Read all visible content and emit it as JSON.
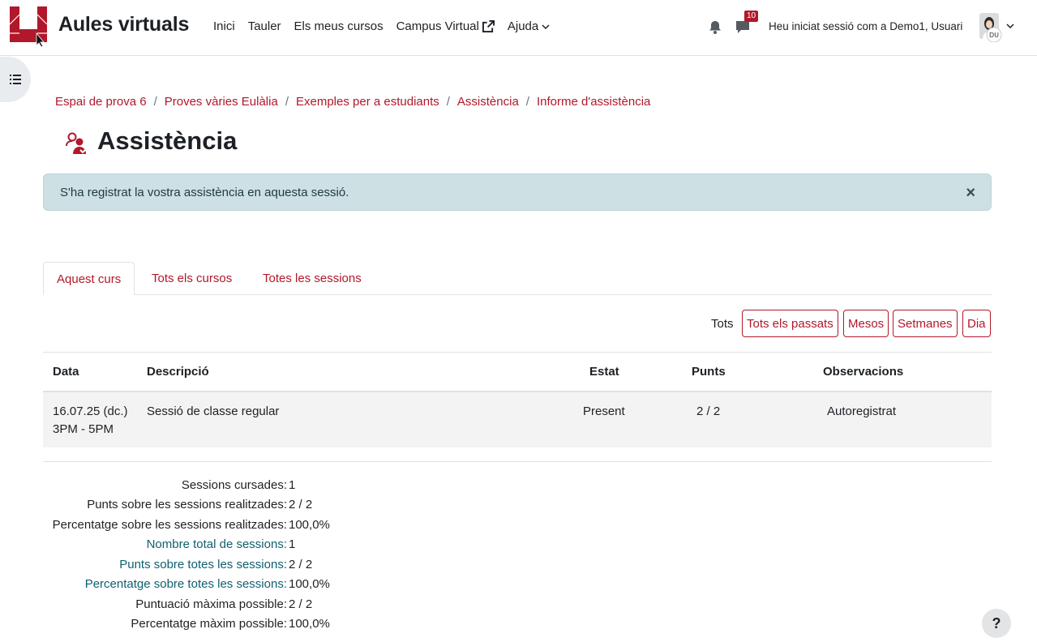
{
  "header": {
    "brand": "Aules virtuals",
    "nav": [
      {
        "label": "Inici"
      },
      {
        "label": "Tauler"
      },
      {
        "label": "Els meus cursos"
      },
      {
        "label": "Campus Virtual"
      },
      {
        "label": "Ajuda"
      }
    ],
    "message_count": "10",
    "login_text": "Heu iniciat sessió com a Demo1, Usuari",
    "avatar_initials": "DU"
  },
  "breadcrumb": [
    "Espai de prova 6",
    "Proves vàries Eulàlia",
    "Exemples per a estudiants",
    "Assistència",
    "Informe d'assistència"
  ],
  "page_title": "Assistència",
  "alert": {
    "text": "S'ha registrat la vostra assistència en aquesta sessió.",
    "close": "×"
  },
  "tabs": [
    "Aquest curs",
    "Tots els cursos",
    "Totes les sessions"
  ],
  "filters": {
    "label": "Tots",
    "buttons": [
      "Tots els passats",
      "Mesos",
      "Setmanes",
      "Dia"
    ]
  },
  "table": {
    "headers": [
      "Data",
      "Descripció",
      "Estat",
      "Punts",
      "Observacions"
    ],
    "rows": [
      {
        "date": "16.07.25 (dc.)",
        "time": "3PM - 5PM",
        "description": "Sessió de classe regular",
        "status": "Present",
        "points": "2 / 2",
        "observations": "Autoregistrat"
      }
    ]
  },
  "summary": [
    {
      "label": "Sessions cursades:",
      "value": "1"
    },
    {
      "label": "Punts sobre les sessions realitzades:",
      "value": "2 / 2"
    },
    {
      "label": "Percentatge sobre les sessions realitzades:",
      "value": "100,0%"
    },
    {
      "label": "Nombre total de sessions:",
      "value": "1"
    },
    {
      "label": "Punts sobre totes les sessions:",
      "value": "2 / 2"
    },
    {
      "label": "Percentatge sobre totes les sessions:",
      "value": "100,0%"
    },
    {
      "label": "Puntuació màxima possible:",
      "value": "2 / 2"
    },
    {
      "label": "Percentatge màxim possible:",
      "value": "100,0%"
    }
  ],
  "help": "?",
  "colors": {
    "brand": "#b1182b",
    "alert_bg": "#cde0e3",
    "summary_link": "#0f5f6e"
  }
}
